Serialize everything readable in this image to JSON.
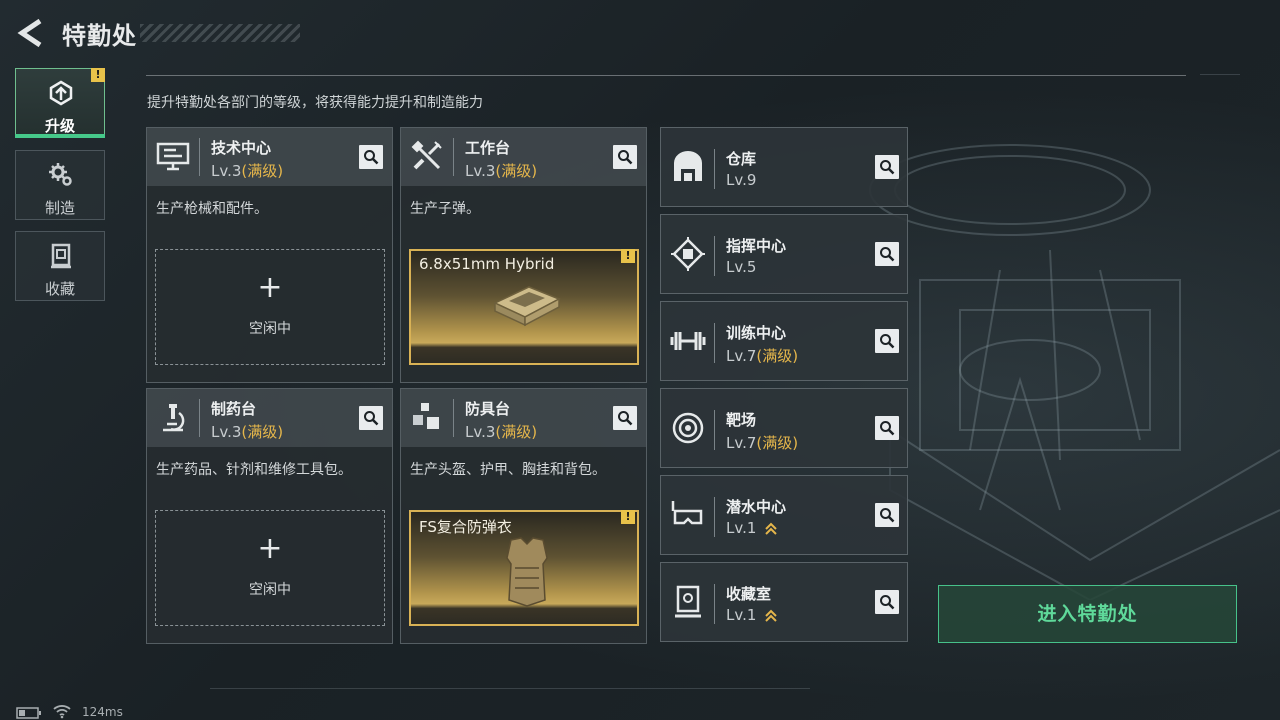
{
  "header": {
    "title": "特勤处"
  },
  "sidebar": {
    "tabs": [
      {
        "label": "升级",
        "icon": "upgrade-icon",
        "active": true,
        "warning": "!"
      },
      {
        "label": "制造",
        "icon": "gear-cluster-icon",
        "active": false
      },
      {
        "label": "收藏",
        "icon": "collection-icon",
        "active": false
      }
    ]
  },
  "description": "提升特勤处各部门的等级，将获得能力提升和制造能力",
  "cards": [
    {
      "name": "技术中心",
      "level": "Lv.3",
      "level_note": "(满级)",
      "icon": "computer-icon",
      "desc": "生产枪械和配件。",
      "slot": {
        "type": "idle",
        "plus": "+",
        "label": "空闲中"
      }
    },
    {
      "name": "工作台",
      "level": "Lv.3",
      "level_note": "(满级)",
      "icon": "tools-icon",
      "desc": "生产子弹。",
      "slot": {
        "type": "item",
        "name": "6.8x51mm Hybrid",
        "warning": "!"
      }
    },
    {
      "name": "制药台",
      "level": "Lv.3",
      "level_note": "(满级)",
      "icon": "microscope-icon",
      "desc": "生产药品、针剂和维修工具包。",
      "slot": {
        "type": "idle",
        "plus": "+",
        "label": "空闲中"
      }
    },
    {
      "name": "防具台",
      "level": "Lv.3",
      "level_note": "(满级)",
      "icon": "boxes-icon",
      "desc": "生产头盔、护甲、胸挂和背包。",
      "slot": {
        "type": "item",
        "name": "FS复合防弹衣",
        "warning": "!"
      }
    }
  ],
  "facilities": [
    {
      "name": "仓库",
      "level": "Lv.9",
      "level_note": "",
      "icon": "warehouse-icon",
      "upgradable": false
    },
    {
      "name": "指挥中心",
      "level": "Lv.5",
      "level_note": "",
      "icon": "chip-icon",
      "upgradable": false
    },
    {
      "name": "训练中心",
      "level": "Lv.7",
      "level_note": "(满级)",
      "icon": "dumbbell-icon",
      "upgradable": false
    },
    {
      "name": "靶场",
      "level": "Lv.7",
      "level_note": "(满级)",
      "icon": "target-icon",
      "upgradable": false
    },
    {
      "name": "潜水中心",
      "level": "Lv.1",
      "level_note": "",
      "icon": "diving-mask-icon",
      "upgradable": true
    },
    {
      "name": "收藏室",
      "level": "Lv.1",
      "level_note": "",
      "icon": "collection-room-icon",
      "upgradable": true
    }
  ],
  "enter_button": "进入特勤处",
  "status": {
    "latency": "124ms"
  },
  "colors": {
    "accent_green": "#47c28a",
    "gold": "#e5b64b",
    "warning": "#e8c24a"
  }
}
